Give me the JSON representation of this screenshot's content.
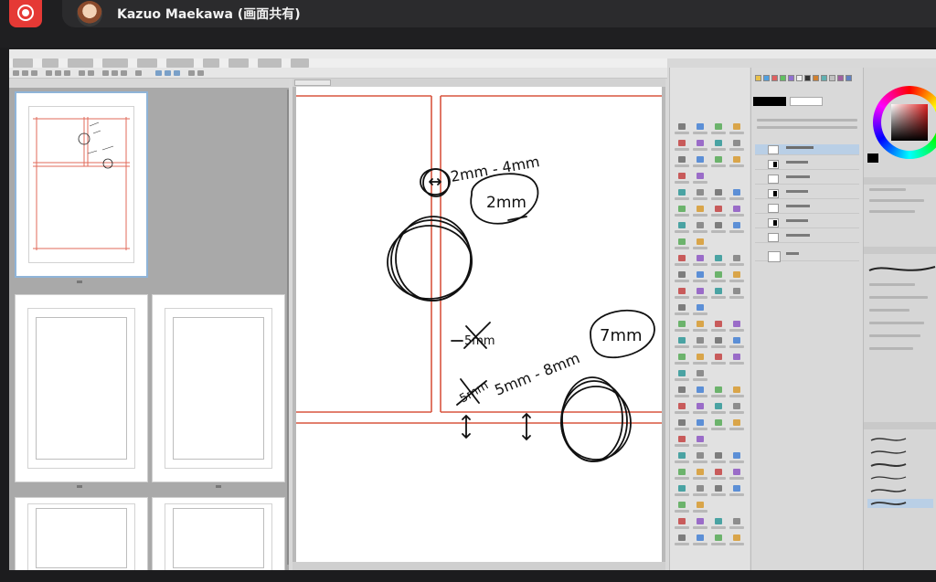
{
  "zoom_bar": {
    "presenter_name": "Kazuo Maekawa (画面共有)"
  },
  "canvas": {
    "annotations": {
      "top_range": "2mm - 4mm",
      "top_circled": "2mm",
      "crossed_out_left": "5mm",
      "crossed_out_lower": "5mm",
      "bottom_range": "5mm - 8mm",
      "bottom_circled": "7mm"
    }
  }
}
